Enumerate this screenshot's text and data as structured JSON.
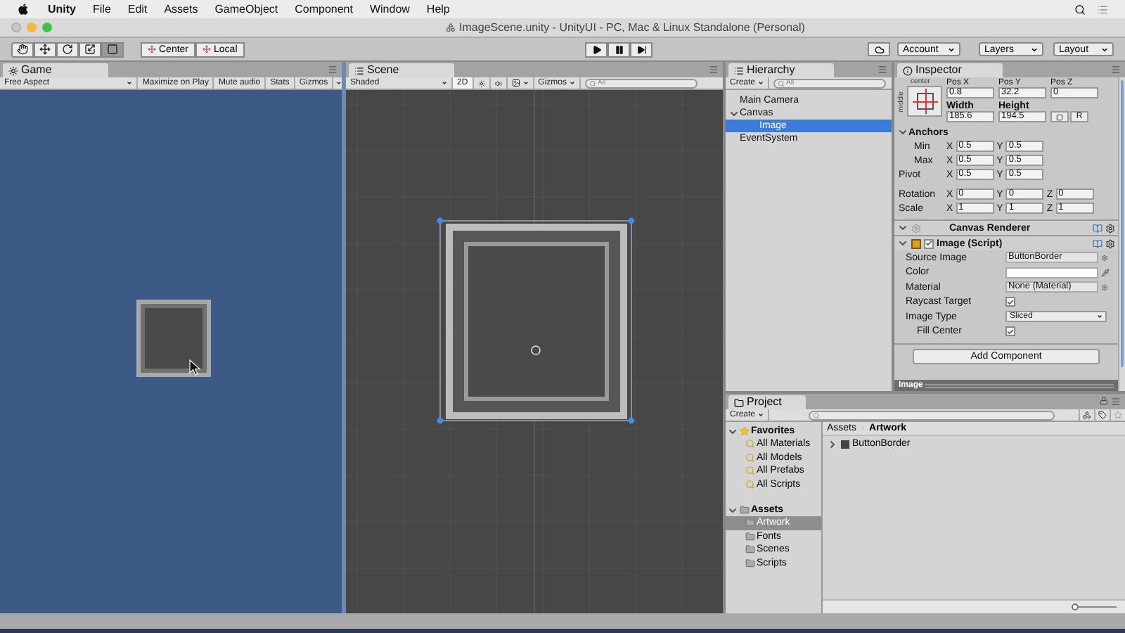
{
  "menu_bar": {
    "app": "Unity",
    "items": [
      "File",
      "Edit",
      "Assets",
      "GameObject",
      "Component",
      "Window",
      "Help"
    ]
  },
  "window": {
    "title": "ImageScene.unity - UnityUI - PC, Mac & Linux Standalone (Personal)"
  },
  "toolbar": {
    "tools": [
      {
        "kind": "hand",
        "selected": false
      },
      {
        "kind": "move",
        "selected": false
      },
      {
        "kind": "rotate",
        "selected": false
      },
      {
        "kind": "scale",
        "selected": false
      },
      {
        "kind": "rect",
        "selected": true
      }
    ],
    "pivot": [
      "Center",
      "Local"
    ],
    "playback": [
      {
        "kind": "play"
      },
      {
        "kind": "pause"
      },
      {
        "kind": "step"
      }
    ],
    "account": "Account",
    "layers": "Layers",
    "layout": "Layout"
  },
  "game": {
    "tab": "Game",
    "aspect": "Free Aspect",
    "buttons": [
      "Maximize on Play",
      "Mute audio",
      "Stats",
      "Gizmos"
    ]
  },
  "scene": {
    "tab": "Scene",
    "shading": "Shaded",
    "mode": "2D",
    "toggles": [
      {
        "kind": "lighting",
        "on": false
      },
      {
        "kind": "audio",
        "on": false
      },
      {
        "kind": "effects",
        "on": false
      }
    ],
    "gizmos": "Gizmos",
    "search": {
      "placeholder": "All"
    }
  },
  "hierarchy": {
    "tab": "Hierarchy",
    "create": "Create",
    "search": {
      "placeholder": "All"
    },
    "items": [
      {
        "label": "Main Camera",
        "selected": false
      },
      {
        "label": "Canvas",
        "selected": false,
        "expanded": true,
        "children": [
          {
            "label": "Image",
            "selected": true
          }
        ]
      },
      {
        "label": "EventSystem",
        "selected": false
      }
    ]
  },
  "inspector": {
    "tab": "Inspector",
    "anchor_labels": [
      "center",
      "middle"
    ],
    "rect_fields": [
      {
        "label": "Pos X",
        "value": "0.8"
      },
      {
        "label": "Pos Y",
        "value": "32.2"
      },
      {
        "label": "Pos Z",
        "value": "0"
      },
      {
        "label": "Width",
        "value": "185.6"
      },
      {
        "label": "Height",
        "value": "194.5"
      }
    ],
    "raw_button": "R",
    "anchors": {
      "label": "Anchors",
      "expanded": true,
      "rows": [
        {
          "label": "Min",
          "fields": [
            {
              "axis": "X",
              "value": "0.5"
            },
            {
              "axis": "Y",
              "value": "0.5"
            }
          ]
        },
        {
          "label": "Max",
          "fields": [
            {
              "axis": "X",
              "value": "0.5"
            },
            {
              "axis": "Y",
              "value": "0.5"
            }
          ]
        }
      ]
    },
    "transform_rows": [
      {
        "label": "Pivot",
        "fields": [
          {
            "axis": "X",
            "value": "0.5"
          },
          {
            "axis": "Y",
            "value": "0.5"
          }
        ]
      },
      {
        "label": "Rotation",
        "fields": [
          {
            "axis": "X",
            "value": "0"
          },
          {
            "axis": "Y",
            "value": "0"
          },
          {
            "axis": "Z",
            "value": "0"
          }
        ]
      },
      {
        "label": "Scale",
        "fields": [
          {
            "axis": "X",
            "value": "1"
          },
          {
            "axis": "Y",
            "value": "1"
          },
          {
            "axis": "Z",
            "value": "1"
          }
        ]
      }
    ],
    "components": [
      {
        "kind": "renderer",
        "name": "Canvas Renderer",
        "expanded": true
      },
      {
        "kind": "script",
        "name": "Image (Script)",
        "expanded": true,
        "enabled": true,
        "properties": [
          {
            "kind": "object",
            "label": "Source Image",
            "value": "ButtonBorder"
          },
          {
            "kind": "color",
            "label": "Color"
          },
          {
            "kind": "object",
            "label": "Material",
            "value": "None (Material)"
          },
          {
            "kind": "checkbox",
            "label": "Raycast Target",
            "checked": true
          },
          {
            "kind": "dropdown",
            "label": "Image Type",
            "value": "Sliced",
            "children": [
              {
                "kind": "checkbox",
                "label": "Fill Center",
                "checked": true
              }
            ]
          }
        ]
      }
    ],
    "add_component": "Add Component",
    "preview": "Image"
  },
  "project": {
    "tab": "Project",
    "create": "Create",
    "favorites": {
      "label": "Favorites",
      "expanded": true,
      "items": [
        "All Materials",
        "All Models",
        "All Prefabs",
        "All Scripts"
      ]
    },
    "assets": {
      "label": "Assets",
      "expanded": true,
      "children": [
        {
          "label": "Artwork",
          "selected": true
        },
        {
          "label": "Fonts",
          "selected": false
        },
        {
          "label": "Scenes",
          "selected": false
        },
        {
          "label": "Scripts",
          "selected": false
        }
      ]
    },
    "breadcrumb": [
      "Assets",
      "Artwork"
    ],
    "files": [
      {
        "name": "ButtonBorder",
        "expanded": false
      }
    ],
    "zoom": {
      "level": 0
    }
  }
}
